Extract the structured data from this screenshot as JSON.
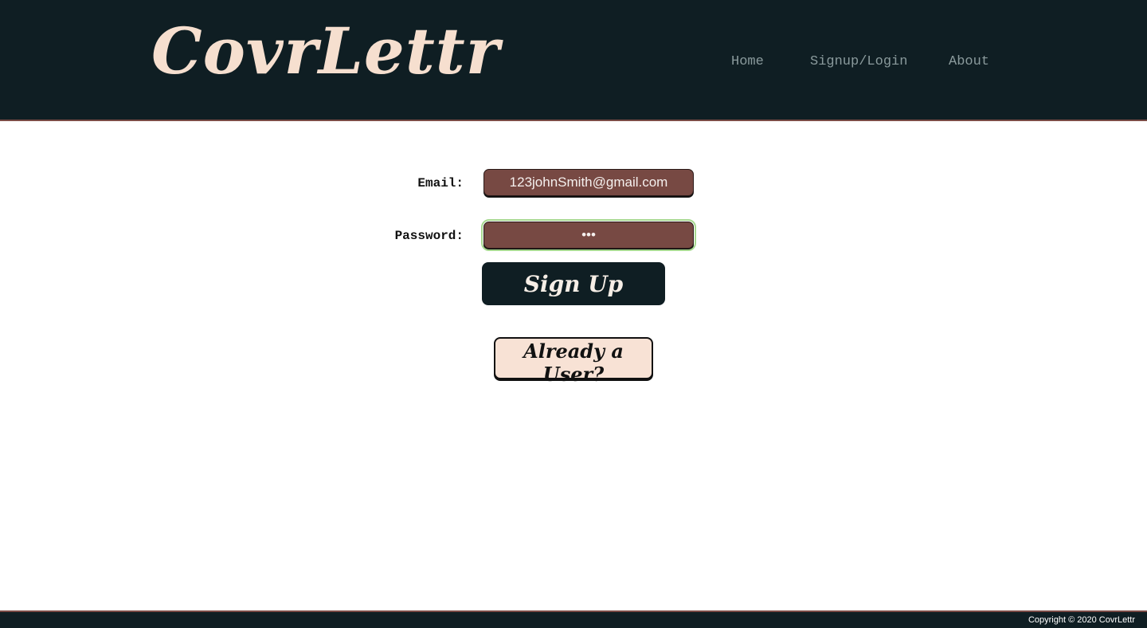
{
  "header": {
    "logo": "CovrLettr",
    "nav": {
      "home": "Home",
      "signup_login": "Signup/Login",
      "about": "About"
    }
  },
  "form": {
    "email_label": "Email:",
    "email_value": "123johnSmith@gmail.com",
    "password_label": "Password:",
    "password_value": "•••",
    "signup_label": "Sign Up",
    "already_user_label": "Already a User?"
  },
  "footer": {
    "copyright": "Copyright © 2020 CovrLettr"
  },
  "colors": {
    "header_bg": "#0f1e23",
    "logo": "#f6dfcf",
    "field_bg": "#774943",
    "focus_ring": "#a6d88f",
    "secondary_button_bg": "#f8e2d5"
  }
}
